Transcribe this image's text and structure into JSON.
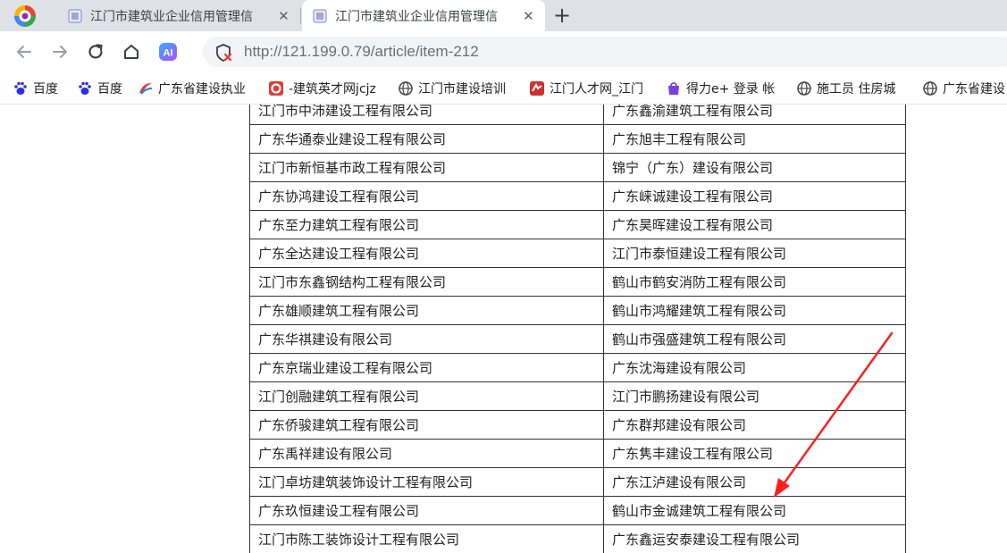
{
  "tabs": [
    {
      "title": "江门市建筑业企业信用管理信",
      "close": "✕"
    },
    {
      "title": "江门市建筑业企业信用管理信",
      "close": "✕"
    }
  ],
  "new_tab": "+",
  "toolbar": {
    "ai_label": "AI",
    "url": "http://121.199.0.79/article/item-212"
  },
  "bookmarks": [
    {
      "label": "百度",
      "icon": "paw-icon",
      "color": "#2932e1"
    },
    {
      "label": "百度",
      "icon": "paw-icon",
      "color": "#2932e1"
    },
    {
      "label": "广东省建设执业",
      "icon": "swoosh-icon",
      "color": "#e53935"
    },
    {
      "label": "-建筑英才网jcjz",
      "icon": "ring-icon",
      "color": "#e53935"
    },
    {
      "label": "江门市建设培训",
      "icon": "globe-icon",
      "color": "#444444"
    },
    {
      "label": "江门人才网_江门",
      "icon": "red-badge-icon",
      "color": "#d32f2f"
    },
    {
      "label": "得力e+ 登录 帐",
      "icon": "purple-bag-icon",
      "color": "#7b3fe4"
    },
    {
      "label": "施工员 住房城",
      "icon": "globe-icon",
      "color": "#444444"
    },
    {
      "label": "广东省建设",
      "icon": "globe-icon",
      "color": "#444444"
    }
  ],
  "table": {
    "rows": [
      [
        "江门市中沛建设工程有限公司",
        "广东鑫渝建筑工程有限公司"
      ],
      [
        "广东华通泰业建设工程有限公司",
        "广东旭丰工程有限公司"
      ],
      [
        "江门市新恒基市政工程有限公司",
        "锦宁（广东）建设有限公司"
      ],
      [
        "广东协鸿建设工程有限公司",
        "广东崃诚建设工程有限公司"
      ],
      [
        "广东至力建筑工程有限公司",
        "广东昊晖建设工程有限公司"
      ],
      [
        "广东全达建设工程有限公司",
        "江门市泰恒建设工程有限公司"
      ],
      [
        "江门市东鑫钢结构工程有限公司",
        "鹤山市鹤安消防工程有限公司"
      ],
      [
        "广东雄顺建筑工程有限公司",
        "鹤山市鸿耀建筑工程有限公司"
      ],
      [
        "广东华祺建设有限公司",
        "鹤山市强盛建筑工程有限公司"
      ],
      [
        "广东京瑞业建设工程有限公司",
        "广东沈海建设有限公司"
      ],
      [
        "江门创融建筑工程有限公司",
        "江门市鹏扬建设有限公司"
      ],
      [
        "广东侨骏建筑工程有限公司",
        "广东群邦建设有限公司"
      ],
      [
        "广东禹祥建设有限公司",
        "广东隽丰建设工程有限公司"
      ],
      [
        "江门卓坊建筑装饰设计工程有限公司",
        "广东江泸建设有限公司"
      ],
      [
        "广东玖恒建设工程有限公司",
        "鹤山市金诚建筑工程有限公司"
      ],
      [
        "江门市陈工装饰设计工程有限公司",
        "广东鑫运安泰建设工程有限公司"
      ]
    ]
  },
  "annotation": {
    "color": "#ff2020"
  }
}
